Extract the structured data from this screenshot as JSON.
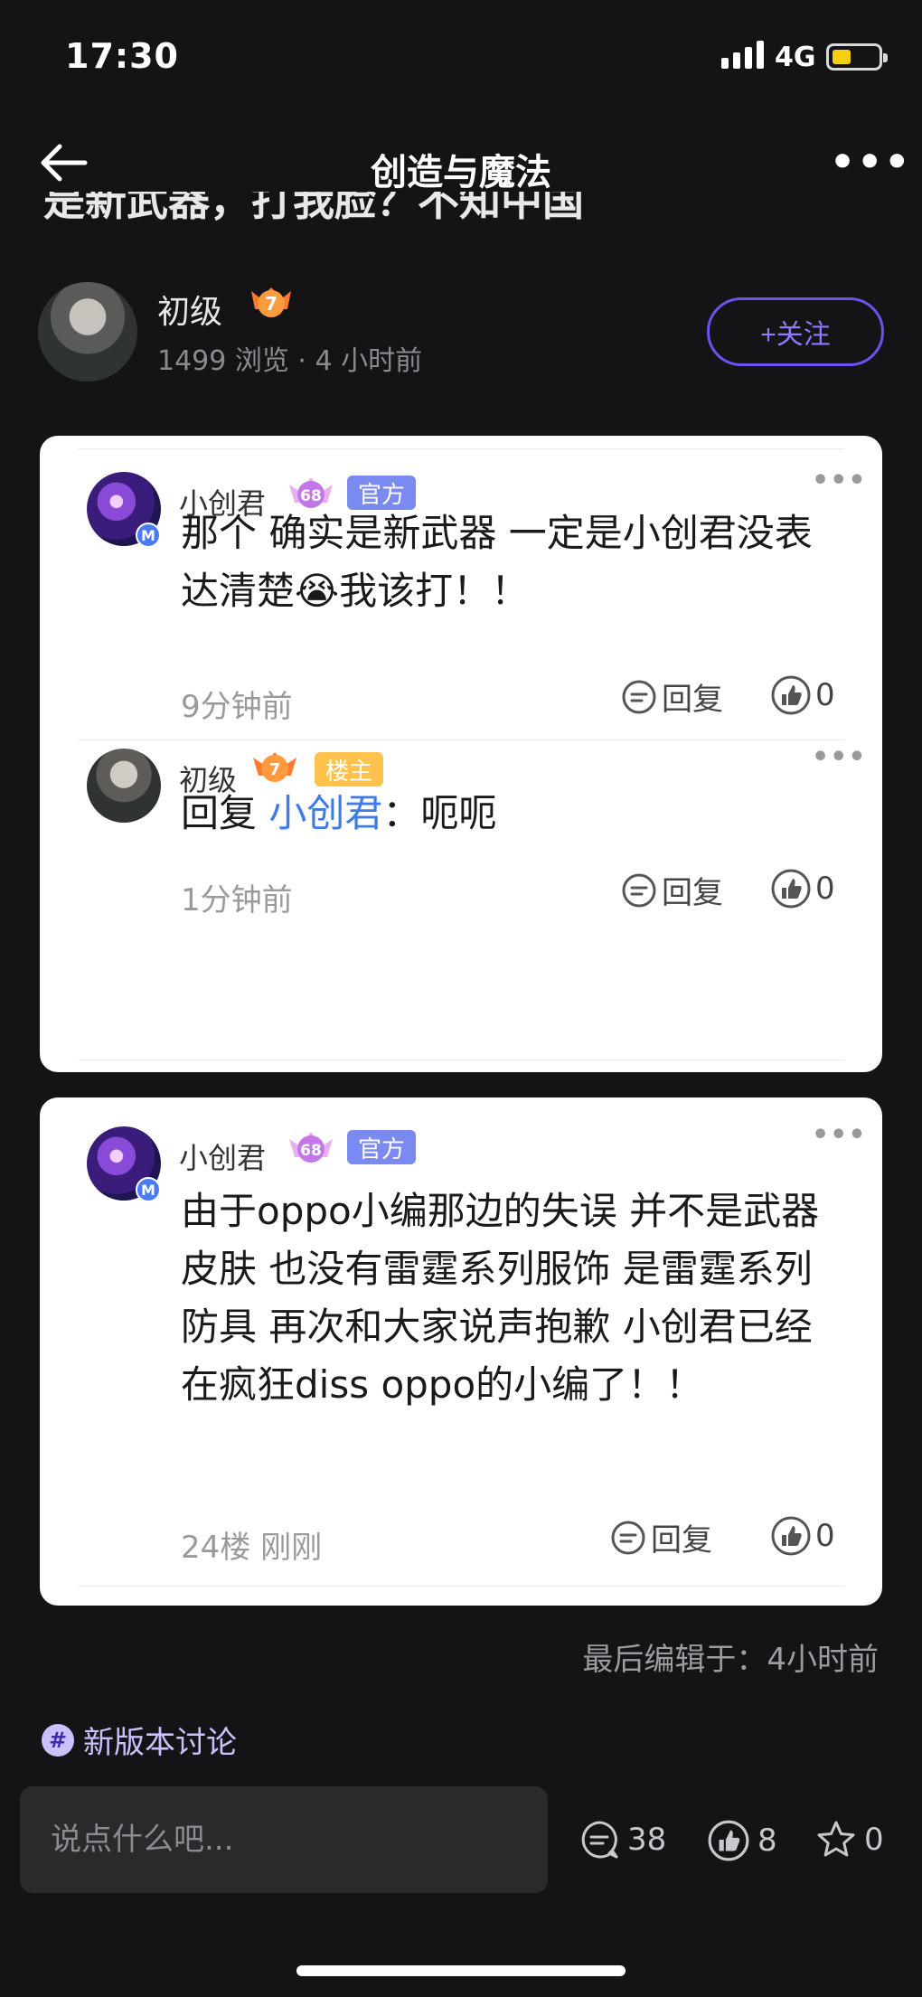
{
  "status_bar": {
    "time": "17:30",
    "network": "4G"
  },
  "nav": {
    "title": "创造与魔法"
  },
  "post_peek": "是新武器，打我脸？不知中国",
  "author": {
    "name": "初级",
    "level": "7",
    "meta": "1499 浏览 · 4 小时前",
    "follow_label": "+关注"
  },
  "comments": [
    {
      "name": "小创君",
      "level": "68",
      "tag": "官方",
      "text": "那个 确实是新武器 一定是小创君没表达清楚😭我该打！！",
      "time": "9分钟前",
      "reply_label": "回复",
      "likes": "0"
    },
    {
      "name": "初级",
      "level": "7",
      "tag": "楼主",
      "reply_prefix": "回复 ",
      "reply_to": "小创君",
      "reply_text": "：呃呃",
      "time": "1分钟前",
      "reply_label": "回复",
      "likes": "0"
    },
    {
      "name": "小创君",
      "level": "68",
      "tag": "官方",
      "text": "由于oppo小编那边的失误 并不是武器皮肤 也没有雷霆系列服饰 是雷霆系列防具 再次和大家说声抱歉 小创君已经在疯狂diss oppo的小编了！！",
      "time": "24楼  刚刚",
      "reply_label": "回复",
      "likes": "0"
    }
  ],
  "edited": "最后编辑于：4小时前",
  "topic": {
    "icon": "#",
    "label": "新版本讨论"
  },
  "bottom_bar": {
    "placeholder": "说点什么吧...",
    "comments": "38",
    "likes": "8",
    "favorites": "0"
  },
  "colors": {
    "accent": "#6d52f0",
    "mention": "#3d7be8",
    "official_tag": "#7b8af0",
    "owner_tag": "#ffc34d"
  }
}
